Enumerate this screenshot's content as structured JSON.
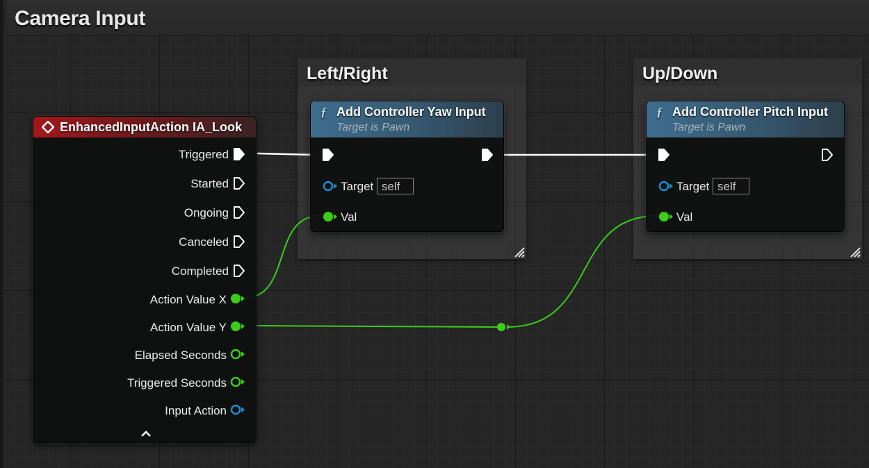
{
  "graph": {
    "main_comment": {
      "title": "Camera Input"
    },
    "comments": [
      {
        "title": "Left/Right"
      },
      {
        "title": "Up/Down"
      }
    ]
  },
  "event_node": {
    "title": "EnhancedInputAction IA_Look",
    "pins": [
      {
        "label": "Triggered"
      },
      {
        "label": "Started"
      },
      {
        "label": "Ongoing"
      },
      {
        "label": "Canceled"
      },
      {
        "label": "Completed"
      },
      {
        "label": "Action Value X"
      },
      {
        "label": "Action Value Y"
      },
      {
        "label": "Elapsed Seconds"
      },
      {
        "label": "Triggered Seconds"
      },
      {
        "label": "Input Action"
      }
    ],
    "collapse_icon": "chevron-up-icon"
  },
  "yaw_node": {
    "title": "Add Controller Yaw Input",
    "subtitle": "Target is Pawn",
    "target_label": "Target",
    "target_value": "self",
    "val_label": "Val"
  },
  "pitch_node": {
    "title": "Add Controller Pitch Input",
    "subtitle": "Target is Pawn",
    "target_label": "Target",
    "target_value": "self",
    "val_label": "Val"
  },
  "colors": {
    "event_header": "#a3181b",
    "function_header": "#3f6d8e",
    "exec_wire": "#ffffff",
    "float_pin": "#3ccd1a",
    "object_pin": "#1b8ed0"
  }
}
